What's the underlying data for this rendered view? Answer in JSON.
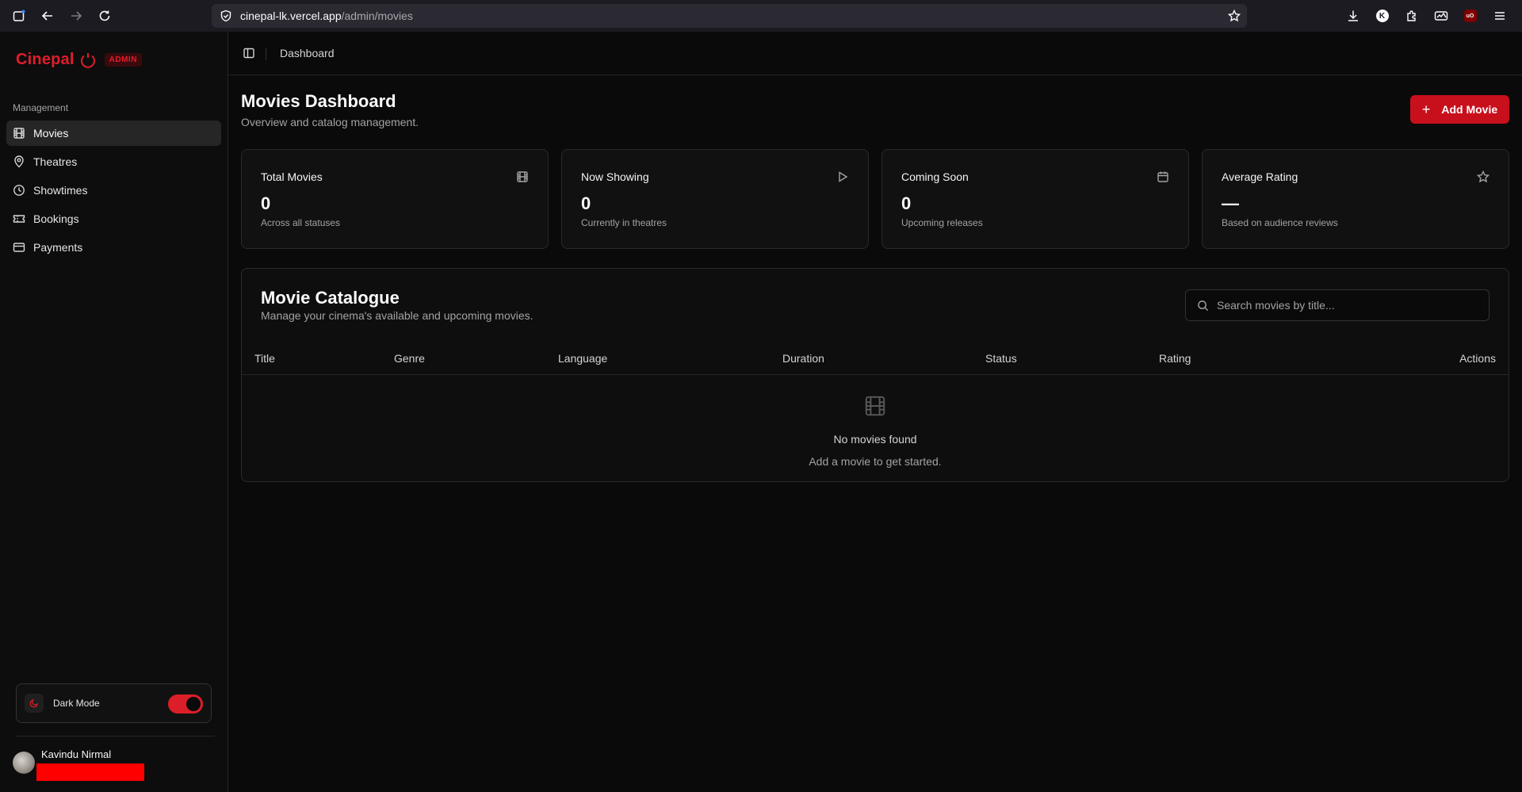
{
  "browser": {
    "url_host": "cinepal-lk.vercel.app",
    "url_path": "/admin/movies",
    "k_avatar": "K",
    "ub_label": "uO"
  },
  "sidebar": {
    "brand": "Cinepal",
    "badge": "ADMIN",
    "group_label": "Management",
    "items": [
      {
        "label": "Movies",
        "icon": "film-icon",
        "active": true
      },
      {
        "label": "Theatres",
        "icon": "map-pin-icon"
      },
      {
        "label": "Showtimes",
        "icon": "clock-icon"
      },
      {
        "label": "Bookings",
        "icon": "ticket-icon"
      },
      {
        "label": "Payments",
        "icon": "credit-card-icon"
      }
    ],
    "theme_label": "Dark Mode",
    "theme_on": true,
    "user_name": "Kavindu Nirmal"
  },
  "topbar": {
    "breadcrumb": "Dashboard"
  },
  "page": {
    "title": "Movies Dashboard",
    "subtitle": "Overview and catalog management.",
    "add_button": "Add Movie"
  },
  "stats": [
    {
      "title": "Total Movies",
      "value": "0",
      "desc": "Across all statuses",
      "icon": "film-icon"
    },
    {
      "title": "Now Showing",
      "value": "0",
      "desc": "Currently in theatres",
      "icon": "play-icon"
    },
    {
      "title": "Coming Soon",
      "value": "0",
      "desc": "Upcoming releases",
      "icon": "calendar-icon"
    },
    {
      "title": "Average Rating",
      "value": "—",
      "desc": "Based on audience reviews",
      "icon": "star-icon"
    }
  ],
  "catalogue": {
    "title": "Movie Catalogue",
    "subtitle": "Manage your cinema's available and upcoming movies.",
    "search_placeholder": "Search movies by title...",
    "columns": [
      "Title",
      "Genre",
      "Language",
      "Duration",
      "Status",
      "Rating",
      "Actions"
    ],
    "empty_title": "No movies found",
    "empty_subtitle": "Add a movie to get started."
  },
  "colors": {
    "accent": "#e11d2a",
    "background": "#0a0a0a"
  }
}
